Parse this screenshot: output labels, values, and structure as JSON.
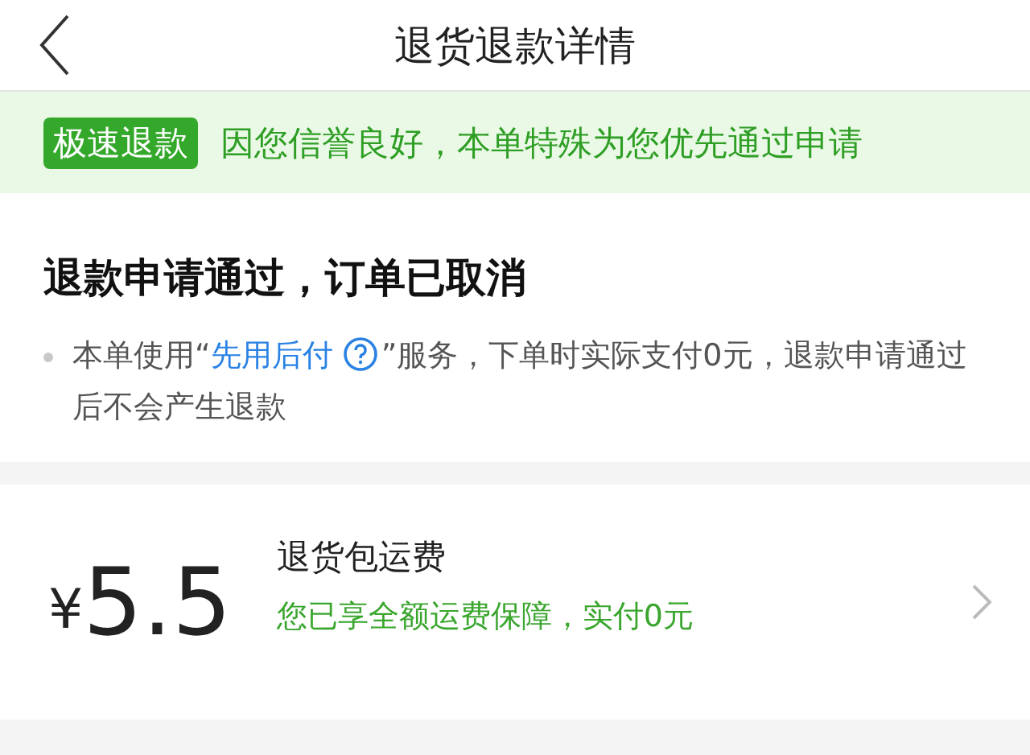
{
  "header": {
    "title": "退货退款详情"
  },
  "banner": {
    "badge": "极速退款",
    "message": "因您信誉良好，本单特殊为您优先通过申请"
  },
  "status": {
    "heading": "退款申请通过，订单已取消",
    "note": {
      "prefix": "本单使用“",
      "link": "先用后付",
      "suffix": "”服务，下单时实际支付0元，退款申请通过后不会产生退款"
    }
  },
  "fee": {
    "currency": "¥",
    "amount": "5.5",
    "label": "退货包运费",
    "detail": "您已享全额运费保障，实付0元"
  }
}
